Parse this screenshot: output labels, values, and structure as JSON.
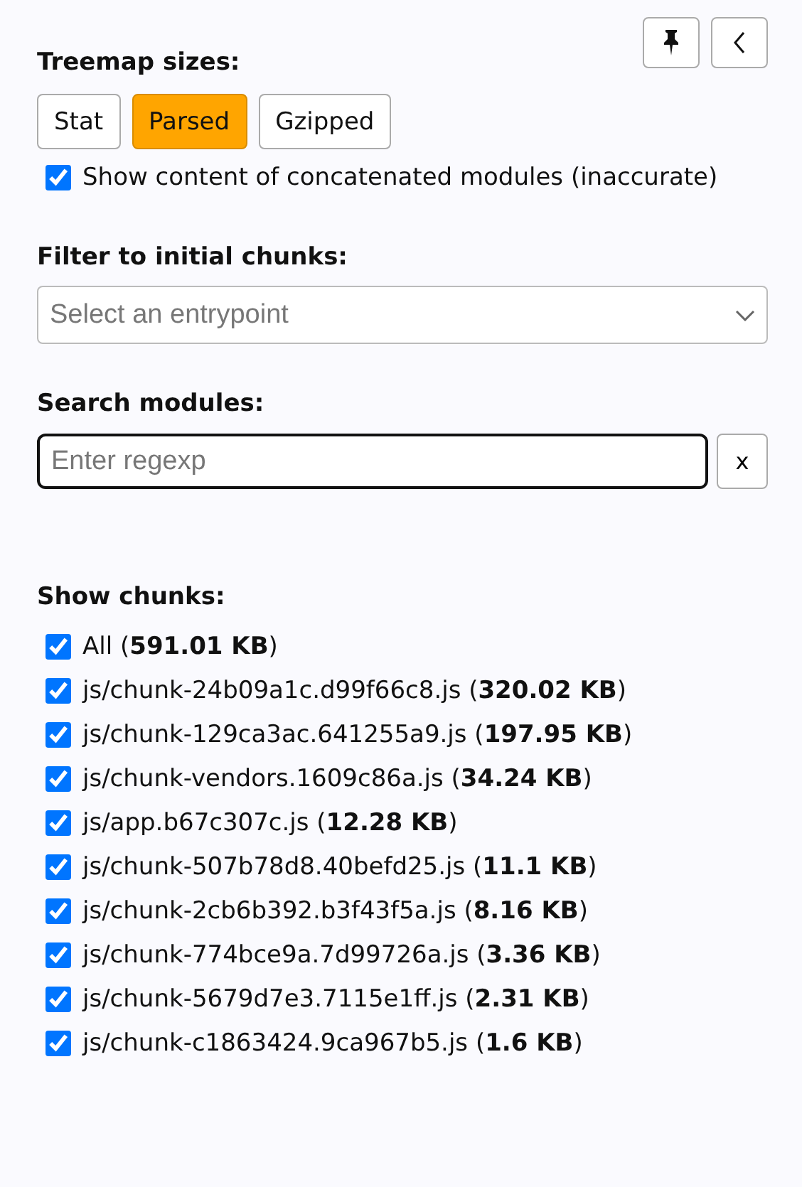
{
  "toolbar": {
    "buttons": [
      {
        "kind": "pin"
      },
      {
        "kind": "collapse"
      }
    ]
  },
  "treemap_sizes": {
    "label": "Treemap sizes:",
    "options": [
      {
        "label": "Stat",
        "selected": false
      },
      {
        "label": "Parsed",
        "selected": true
      },
      {
        "label": "Gzipped",
        "selected": false
      }
    ],
    "concatenated": {
      "label": "Show content of concatenated modules (inaccurate)",
      "checked": true
    }
  },
  "filter": {
    "label": "Filter to initial chunks:",
    "placeholder": "Select an entrypoint"
  },
  "search": {
    "label": "Search modules:",
    "placeholder": "Enter regexp",
    "clear": "x"
  },
  "chunks": {
    "label": "Show chunks:",
    "items": [
      {
        "text": "All (**591.01 KB**)",
        "checked": true
      },
      {
        "text": "js/chunk-24b09a1c.d99f66c8.js (**320.02 KB**)",
        "checked": true
      },
      {
        "text": "js/chunk-129ca3ac.641255a9.js (**197.95 KB**)",
        "checked": true
      },
      {
        "text": "js/chunk-vendors.1609c86a.js (**34.24 KB**)",
        "checked": true
      },
      {
        "text": "js/app.b67c307c.js (**12.28 KB**)",
        "checked": true
      },
      {
        "text": "js/chunk-507b78d8.40befd25.js (**11.1 KB**)",
        "checked": true
      },
      {
        "text": "js/chunk-2cb6b392.b3f43f5a.js (**8.16 KB**)",
        "checked": true
      },
      {
        "text": "js/chunk-774bce9a.7d99726a.js (**3.36 KB**)",
        "checked": true
      },
      {
        "text": "js/chunk-5679d7e3.7115e1ff.js (**2.31 KB**)",
        "checked": true
      },
      {
        "text": "js/chunk-c1863424.9ca967b5.js (**1.6 KB**)",
        "checked": true
      }
    ]
  }
}
